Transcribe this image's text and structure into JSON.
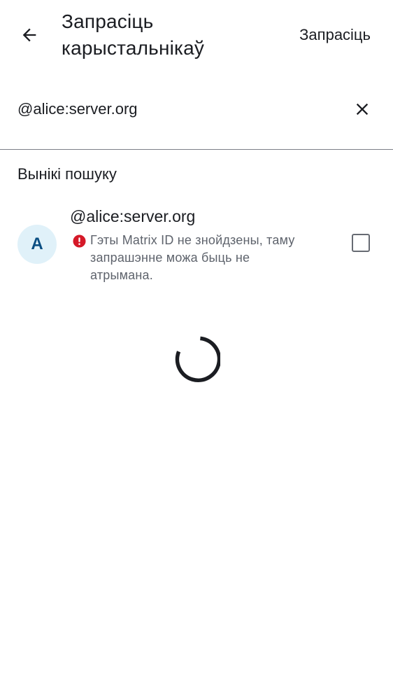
{
  "header": {
    "title_line1": "Запрасіць",
    "title_line2": "карыстальнікаў",
    "action_label": "Запрасіць"
  },
  "search": {
    "value": "@alice:server.org"
  },
  "results": {
    "section_title": "Вынікі пошуку",
    "items": [
      {
        "avatar_letter": "A",
        "name": "@alice:server.org",
        "warning_line1": "Гэты Matrix ID не знойдзены, таму",
        "warning_line2": "запрашэнне можа быць не",
        "warning_line3": "атрымана.",
        "checked": false
      }
    ]
  },
  "icons": {
    "back": "arrow-back-icon",
    "clear": "close-icon",
    "warning": "error-icon",
    "loading": "spinner-icon"
  },
  "colors": {
    "warning": "#d51928",
    "avatar_bg": "#e0f1f9",
    "avatar_text": "#0a4e82"
  }
}
